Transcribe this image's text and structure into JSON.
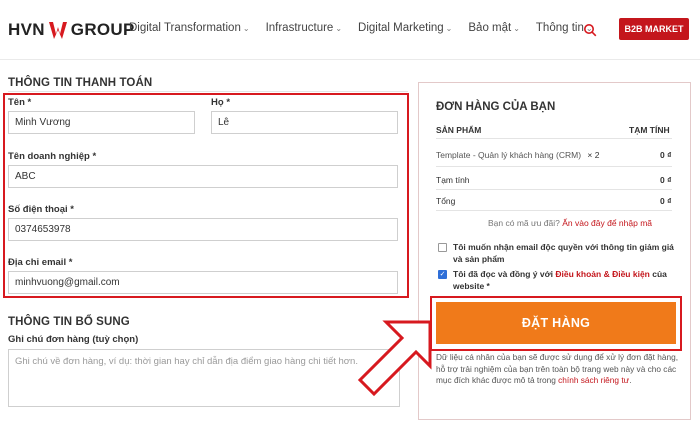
{
  "brand": {
    "left": "HVN",
    "right": "GROUP"
  },
  "nav": {
    "items": [
      {
        "label": "Digital Transformation",
        "chevron": "⌄"
      },
      {
        "label": "Infrastructure",
        "chevron": "⌄"
      },
      {
        "label": "Digital Marketing",
        "chevron": "⌄"
      },
      {
        "label": "Bảo mật",
        "chevron": "⌄"
      },
      {
        "label": "Thông tin",
        "chevron": "⌄"
      }
    ],
    "b2b_label": "B2B MARKET"
  },
  "billing": {
    "title": "THÔNG TIN THANH TOÁN",
    "first_name": {
      "label": "Tên",
      "required": "*",
      "value": "Minh Vương"
    },
    "last_name": {
      "label": "Họ",
      "required": "*",
      "value": "Lê"
    },
    "company": {
      "label": "Tên doanh nghiệp",
      "required": "*",
      "value": "ABC"
    },
    "phone": {
      "label": "Số điện thoại",
      "required": "*",
      "value": "0374653978"
    },
    "email": {
      "label": "Địa chỉ email",
      "required": "*",
      "value": "minhvuong@gmail.com"
    }
  },
  "additional": {
    "title": "THÔNG TIN BỔ SUNG",
    "notes_label": "Ghi chú đơn hàng (tuỳ chọn)",
    "notes_placeholder": "Ghi chú về đơn hàng, ví dụ: thời gian hay chỉ dẫn địa điểm giao hàng chi tiết hơn."
  },
  "order": {
    "title": "ĐƠN HÀNG CỦA BẠN",
    "col_product": "SẢN PHẨM",
    "col_subtotal": "TẠM TÍNH",
    "item_name": "Template - Quản lý khách hàng (CRM)",
    "item_qty": "× 2",
    "item_price": "0 ₫",
    "subtotal_label": "Tạm tính",
    "subtotal_value": "0 ₫",
    "total_label": "Tổng",
    "total_value": "0 ₫",
    "coupon_text": "Bạn có mã ưu đãi?",
    "coupon_link": "Ấn vào đây để nhập mã",
    "opt_in_text": "Tôi muốn nhận email độc quyền với thông tin giảm giá và sản phẩm",
    "terms_prefix": "Tôi đã đọc và đồng ý với",
    "terms_link": "Điều khoản & Điều kiện",
    "terms_suffix": "của website *",
    "place_order": "ĐẶT HÀNG",
    "privacy_text": "Dữ liệu cá nhân của bạn sẽ được sử dụng để xử lý đơn đặt hàng, hỗ trợ trải nghiệm của bạn trên toàn bộ trang web này và cho các mục đích khác được mô tả trong",
    "privacy_link": "chính sách riêng tư",
    "privacy_end": "."
  },
  "colors": {
    "accent_red": "#d7191f",
    "button_orange": "#f07a1a",
    "checkbox_blue": "#2f6fd8"
  },
  "icons": {
    "search": "search-icon",
    "logo_mark": "logo-w-mark-icon",
    "annotation": "arrow-annotation-icon"
  }
}
